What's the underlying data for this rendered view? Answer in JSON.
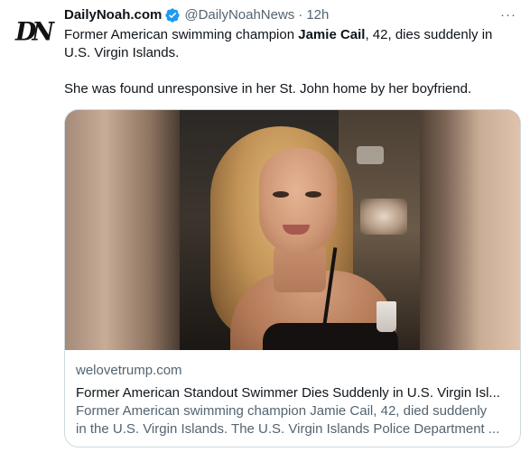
{
  "tweet": {
    "author": {
      "display_name": "DailyNoah.com",
      "handle": "@DailyNoahNews",
      "verified": true,
      "avatar_icon": "daily-noah-logo",
      "avatar_text": "DN"
    },
    "separator": "·",
    "time": "12h",
    "more_icon": "more-horizontal-icon",
    "more_glyph": "···",
    "text": {
      "line1_pre": "Former American swimming champion ",
      "line1_bold": "Jamie Cail",
      "line1_post": ", 42, dies suddenly in",
      "line2": "U.S. Virgin Islands.",
      "line3": "She was found unresponsive in her St. John home by her boyfriend."
    },
    "card": {
      "image_icon": "article-photo",
      "domain": "welovetrump.com",
      "title": "Former American Standout Swimmer Dies Suddenly in U.S. Virgin Isl...",
      "description_line1": "Former American swimming champion Jamie Cail, 42, died suddenly",
      "description_line2": "in the U.S. Virgin Islands. The U.S. Virgin Islands Police Department ..."
    }
  },
  "colors": {
    "text_primary": "#0f1419",
    "text_secondary": "#536471",
    "verified_blue": "#1d9bf0",
    "border": "#cfd9de"
  }
}
